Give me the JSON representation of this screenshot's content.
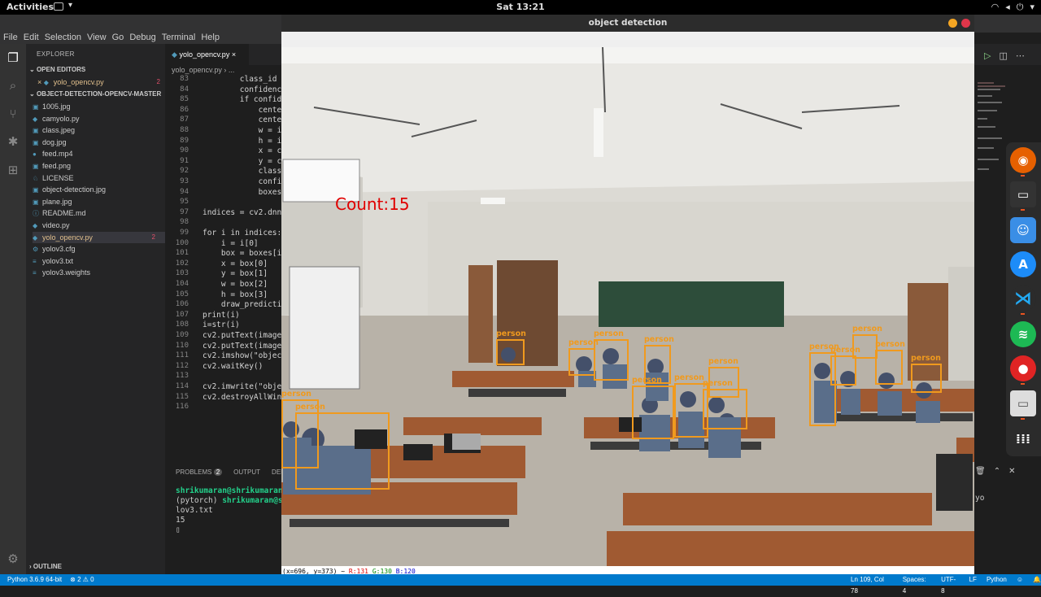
{
  "topbar": {
    "activities": "Activities",
    "clock": "Sat 13:21",
    "tray": [
      "wifi",
      "vol",
      "pwr",
      "▾"
    ]
  },
  "vscode": {
    "menu": [
      "File",
      "Edit",
      "Selection",
      "View",
      "Go",
      "Debug",
      "Terminal",
      "Help"
    ],
    "explorer_title": "EXPLORER",
    "open_editors": "OPEN EDITORS",
    "open_editor_file": "yolo_opencv.py",
    "open_editor_badge": "2",
    "project": "OBJECT-DETECTION-OPENCV-MASTER",
    "files": [
      {
        "name": "1005.jpg",
        "icon": "▣"
      },
      {
        "name": "camyolo.py",
        "icon": "◆"
      },
      {
        "name": "class.jpeg",
        "icon": "▣"
      },
      {
        "name": "dog.jpg",
        "icon": "▣"
      },
      {
        "name": "feed.mp4",
        "icon": "●"
      },
      {
        "name": "feed.png",
        "icon": "▣"
      },
      {
        "name": "LICENSE",
        "icon": "♘"
      },
      {
        "name": "object-detection.jpg",
        "icon": "▣"
      },
      {
        "name": "plane.jpg",
        "icon": "▣"
      },
      {
        "name": "README.md",
        "icon": "ⓘ"
      },
      {
        "name": "video.py",
        "icon": "◆"
      },
      {
        "name": "yolo_opencv.py",
        "icon": "◆"
      },
      {
        "name": "yolov3.cfg",
        "icon": "⚙"
      },
      {
        "name": "yolov3.txt",
        "icon": "≡"
      },
      {
        "name": "yolov3.weights",
        "icon": "≡"
      }
    ],
    "file_badge": "2",
    "outline": "OUTLINE",
    "tab_label": "yolo_opencv.py",
    "tab_close": "×",
    "breadcrumb": "yolo_opencv.py › ...",
    "code": [
      {
        "n": "83",
        "t": "        class_id "
      },
      {
        "n": "84",
        "t": "        confidenc"
      },
      {
        "n": "85",
        "t": "        if confid"
      },
      {
        "n": "86",
        "t": "            cente"
      },
      {
        "n": "87",
        "t": "            cente"
      },
      {
        "n": "88",
        "t": "            w = i"
      },
      {
        "n": "89",
        "t": "            h = i"
      },
      {
        "n": "90",
        "t": "            x = c"
      },
      {
        "n": "91",
        "t": "            y = c"
      },
      {
        "n": "92",
        "t": "            class"
      },
      {
        "n": "93",
        "t": "            confi"
      },
      {
        "n": "94",
        "t": "            boxes"
      },
      {
        "n": "95",
        "t": ""
      },
      {
        "n": "97",
        "t": "indices = cv2.dnn"
      },
      {
        "n": "98",
        "t": ""
      },
      {
        "n": "99",
        "t": "for i in indices:"
      },
      {
        "n": "100",
        "t": "    i = i[0]"
      },
      {
        "n": "101",
        "t": "    box = boxes[i"
      },
      {
        "n": "102",
        "t": "    x = box[0]"
      },
      {
        "n": "103",
        "t": "    y = box[1]"
      },
      {
        "n": "104",
        "t": "    w = box[2]"
      },
      {
        "n": "105",
        "t": "    h = box[3]"
      },
      {
        "n": "106",
        "t": "    draw_predicti"
      },
      {
        "n": "107",
        "t": "print(i)"
      },
      {
        "n": "108",
        "t": "i=str(i)"
      },
      {
        "n": "109",
        "t": "cv2.putText(image"
      },
      {
        "n": "110",
        "t": "cv2.putText(image"
      },
      {
        "n": "111",
        "t": "cv2.imshow(\"objec"
      },
      {
        "n": "112",
        "t": "cv2.waitKey()"
      },
      {
        "n": "113",
        "t": ""
      },
      {
        "n": "114",
        "t": "cv2.imwrite(\"obje"
      },
      {
        "n": "115",
        "t": "cv2.destroyAllWin"
      },
      {
        "n": "116",
        "t": ""
      }
    ],
    "panel_tabs": [
      "PROBLEMS",
      "OUTPUT",
      "DEBU"
    ],
    "problems_count": "2",
    "terminal_lines": [
      "shrikumaran@shrikumaran:",
      "(pytorch) shrikumaran@sh",
      "lov3.txt",
      "15",
      "▯"
    ],
    "terminal_right": "yo",
    "status_left": [
      "Python 3.6.9 64-bit",
      "⊗ 2 ⚠ 0"
    ],
    "status_right": [
      "Ln 109, Col 78",
      "Spaces: 4",
      "UTF-8",
      "LF",
      "Python",
      "☺",
      "🔔"
    ]
  },
  "cv_window": {
    "title": "object detection",
    "count_text": "Count:15",
    "detection_label": "person",
    "detections_shown": 15,
    "pixel_info": {
      "coords": "(x=696, y=373) ~",
      "r": "R:131",
      "g": "G:130",
      "b": "B:120"
    }
  },
  "dock_apps": [
    "firefox",
    "terminal",
    "finder",
    "appstore",
    "vscode",
    "spotify",
    "record",
    "drive",
    "apps-grid"
  ],
  "colors": {
    "detection_box": "#f09a1e",
    "count_text": "#e00000",
    "statusbar": "#007acc"
  }
}
